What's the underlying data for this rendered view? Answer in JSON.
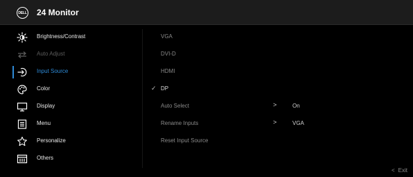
{
  "header": {
    "logo_text": "DELL",
    "title": "24 Monitor"
  },
  "menu": {
    "items": [
      {
        "label": "Brightness/Contrast",
        "icon": "brightness-icon",
        "state": "normal"
      },
      {
        "label": "Auto Adjust",
        "icon": "auto-adjust-icon",
        "state": "disabled"
      },
      {
        "label": "Input Source",
        "icon": "input-source-icon",
        "state": "active"
      },
      {
        "label": "Color",
        "icon": "color-palette-icon",
        "state": "normal"
      },
      {
        "label": "Display",
        "icon": "display-icon",
        "state": "normal"
      },
      {
        "label": "Menu",
        "icon": "menu-icon",
        "state": "normal"
      },
      {
        "label": "Personalize",
        "icon": "star-icon",
        "state": "normal"
      },
      {
        "label": "Others",
        "icon": "others-icon",
        "state": "normal"
      }
    ]
  },
  "submenu": {
    "items": [
      {
        "label": "VGA"
      },
      {
        "label": "DVI-D"
      },
      {
        "label": "HDMI"
      },
      {
        "label": "DP",
        "check": "✓"
      },
      {
        "label": "Auto Select",
        "arrow": ">",
        "value": "On"
      },
      {
        "label": "Rename Inputs",
        "arrow": ">",
        "value": "VGA"
      },
      {
        "label": "Reset Input Source"
      }
    ]
  },
  "footer": {
    "exit_chevron": "<",
    "exit_label": "Exit"
  },
  "colors": {
    "accent": "#2e8bd8",
    "header_bg": "#1c1c1c",
    "background": "#000000"
  }
}
